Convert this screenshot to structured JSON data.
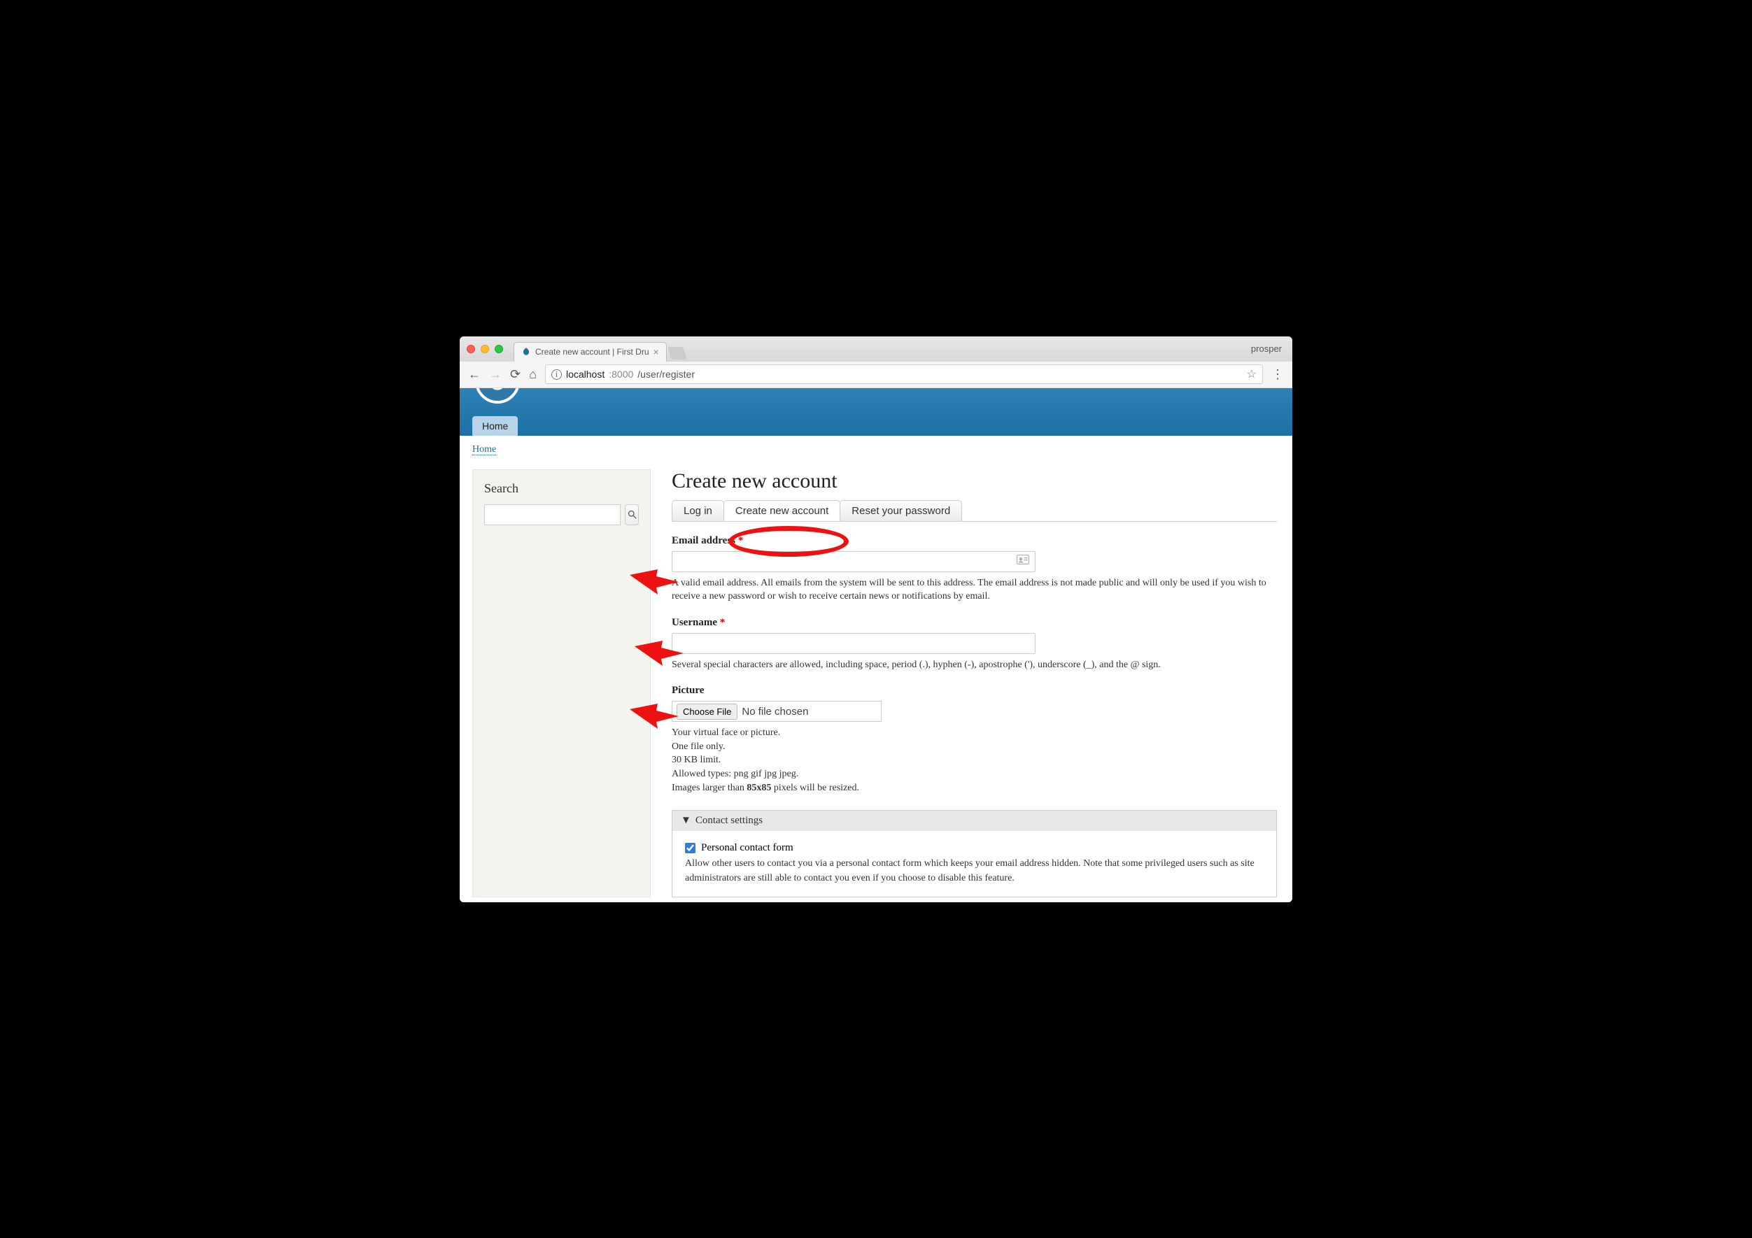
{
  "browser": {
    "tab_title": "Create new account | First Dru",
    "profile": "prosper",
    "url_host": "localhost",
    "url_port": ":8000",
    "url_path": "/user/register"
  },
  "nav": {
    "home": "Home"
  },
  "breadcrumb": {
    "home": "Home"
  },
  "sidebar": {
    "search_heading": "Search"
  },
  "page": {
    "title": "Create new account",
    "tabs": {
      "login": "Log in",
      "create": "Create new account",
      "reset": "Reset your password"
    }
  },
  "form": {
    "email": {
      "label": "Email address",
      "desc": "A valid email address. All emails from the system will be sent to this address. The email address is not made public and will only be used if you wish to receive a new password or wish to receive certain news or notifications by email."
    },
    "username": {
      "label": "Username",
      "desc": "Several special characters are allowed, including space, period (.), hyphen (-), apostrophe ('), underscore (_), and the @ sign."
    },
    "picture": {
      "label": "Picture",
      "button": "Choose File",
      "status": "No file chosen",
      "line1": "Your virtual face or picture.",
      "line2": "One file only.",
      "line3": "30 KB limit.",
      "line4": "Allowed types: png gif jpg jpeg.",
      "line5_pre": "Images larger than ",
      "line5_bold": "85x85",
      "line5_post": " pixels will be resized."
    },
    "contact": {
      "summary": "Contact settings",
      "checkbox_label": "Personal contact form",
      "desc": "Allow other users to contact you via a personal contact form which keeps your email address hidden. Note that some privileged users such as site administrators are still able to contact you even if you choose to disable this feature."
    }
  }
}
